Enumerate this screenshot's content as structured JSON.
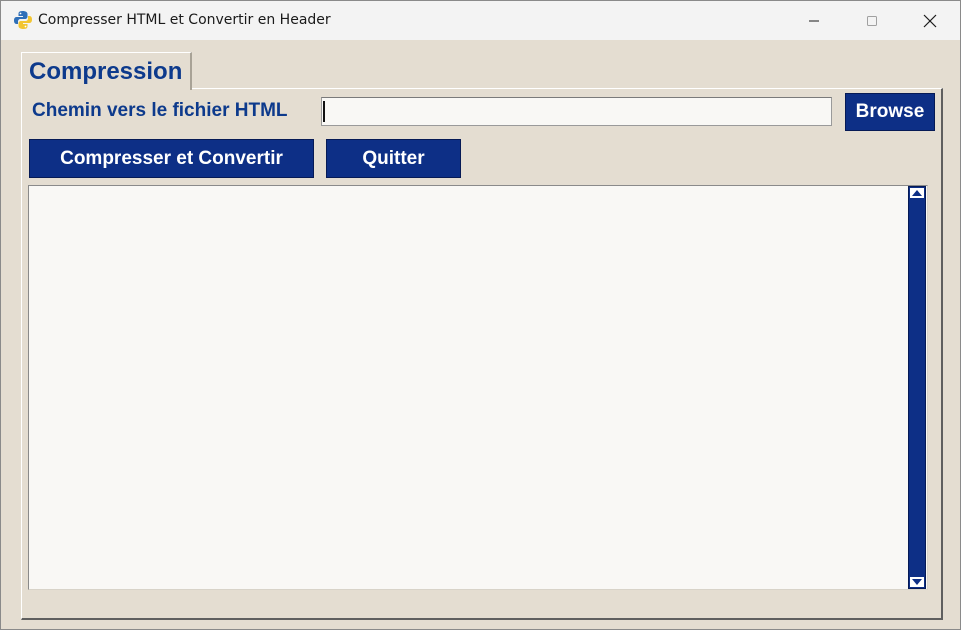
{
  "window": {
    "title": "Compresser HTML et Convertir en Header",
    "icon": "python-icon"
  },
  "tabs": [
    {
      "label": "Compression",
      "selected": true
    }
  ],
  "form": {
    "path_label": "Chemin vers le fichier HTML",
    "path_value": "",
    "browse_label": "Browse"
  },
  "actions": {
    "compress_label": "Compresser et Convertir",
    "quit_label": "Quitter"
  },
  "output": {
    "text": ""
  },
  "colors": {
    "accent": "#0d2f86",
    "label_text": "#0d3a8c",
    "background": "#e4ddd1",
    "field_background": "#f9f8f5"
  }
}
